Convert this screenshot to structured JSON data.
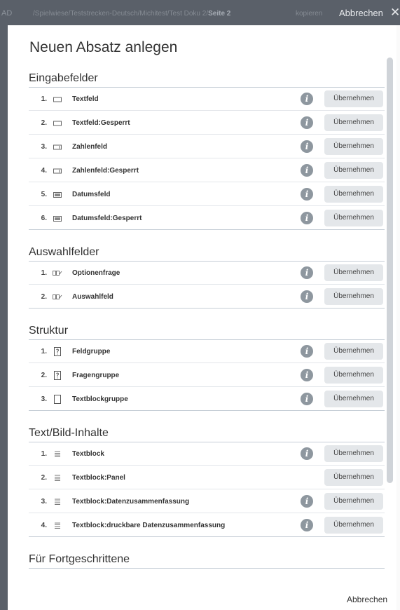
{
  "topbar": {
    "ad": "AD",
    "path": "/Spielwiese/Teststrecken-Deutsch/Michitest/Test Doku 2/",
    "path_current": "Seite 2",
    "copy_label": "kopieren",
    "cancel_label": "Abbrechen",
    "close_glyph": "✕"
  },
  "dialog": {
    "title": "Neuen Absatz anlegen",
    "take_label": "Übernehmen",
    "info_glyph": "i",
    "cancel_label": "Abbrechen"
  },
  "sections": [
    {
      "title": "Eingabefelder",
      "items": [
        {
          "num": "1.",
          "label": "Textfeld",
          "icon": "textfield-icon",
          "info": true
        },
        {
          "num": "2.",
          "label": "Textfeld:Gesperrt",
          "icon": "textfield-icon",
          "info": true
        },
        {
          "num": "3.",
          "label": "Zahlenfeld",
          "icon": "numberfield-icon",
          "info": true
        },
        {
          "num": "4.",
          "label": "Zahlenfeld:Gesperrt",
          "icon": "numberfield-icon",
          "info": true
        },
        {
          "num": "5.",
          "label": "Datumsfeld",
          "icon": "datefield-icon",
          "info": true
        },
        {
          "num": "6.",
          "label": "Datumsfeld:Gesperrt",
          "icon": "datefield-icon",
          "info": true
        }
      ]
    },
    {
      "title": "Auswahlfelder",
      "items": [
        {
          "num": "1.",
          "label": "Optionenfrage",
          "icon": "option-icon",
          "info": true
        },
        {
          "num": "2.",
          "label": "Auswahlfeld",
          "icon": "option-icon",
          "info": true
        }
      ]
    },
    {
      "title": "Struktur",
      "items": [
        {
          "num": "1.",
          "label": "Feldgruppe",
          "icon": "question-group-icon",
          "info": true
        },
        {
          "num": "2.",
          "label": "Fragengruppe",
          "icon": "question-group-icon",
          "info": true
        },
        {
          "num": "3.",
          "label": "Textblockgruppe",
          "icon": "page-icon",
          "info": true
        }
      ]
    },
    {
      "title": "Text/Bild-Inhalte",
      "items": [
        {
          "num": "1.",
          "label": "Textblock",
          "icon": "text-lines-icon",
          "info": true
        },
        {
          "num": "2.",
          "label": "Textblock:Panel",
          "icon": "text-lines-icon",
          "info": false
        },
        {
          "num": "3.",
          "label": "Textblock:Datenzusammenfassung",
          "icon": "text-lines-icon",
          "info": true
        },
        {
          "num": "4.",
          "label": "Textblock:druckbare Datenzusammenfassung",
          "icon": "text-lines-icon",
          "info": true
        }
      ]
    },
    {
      "title": "Für Fortgeschrittene",
      "items": []
    }
  ]
}
